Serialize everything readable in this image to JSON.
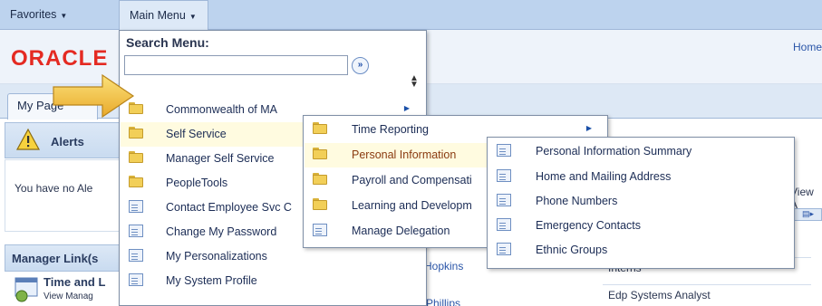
{
  "topbar": {
    "favorites_label": "Favorites",
    "main_menu_label": "Main Menu"
  },
  "header": {
    "logo_text": "ORACLE",
    "home_link": "Home"
  },
  "tabs": {
    "my_page": "My Page"
  },
  "alerts": {
    "title": "Alerts",
    "message": "You have no Ale"
  },
  "manager_links": {
    "title": "Manager Link(s",
    "time_title": "Time and L",
    "view_manage": "View Manag"
  },
  "background": {
    "view_right": "View A",
    "hopkins": "Hopkins",
    "phillips": "Phillips",
    "grid_rows": [
      "Interns",
      "Edp Systems Analyst"
    ]
  },
  "main_menu": {
    "search_title": "Search Menu:",
    "search_placeholder": "",
    "items": [
      {
        "label": "Commonwealth of MA",
        "type": "folder",
        "has_arrow": true
      },
      {
        "label": "Self Service",
        "type": "folder",
        "has_arrow": false,
        "highlighted": true
      },
      {
        "label": "Manager Self Service",
        "type": "folder",
        "has_arrow": false
      },
      {
        "label": "PeopleTools",
        "type": "folder",
        "has_arrow": false
      },
      {
        "label": "Contact Employee Svc C",
        "type": "doc",
        "has_arrow": false
      },
      {
        "label": "Change My Password",
        "type": "doc",
        "has_arrow": false
      },
      {
        "label": "My Personalizations",
        "type": "doc",
        "has_arrow": false
      },
      {
        "label": "My System Profile",
        "type": "doc",
        "has_arrow": false
      }
    ]
  },
  "self_service_menu": {
    "items": [
      {
        "label": "Time Reporting",
        "type": "folder",
        "has_arrow": true
      },
      {
        "label": "Personal Information",
        "type": "folder",
        "highlighted": true
      },
      {
        "label": "Payroll and Compensati",
        "type": "folder"
      },
      {
        "label": "Learning and Developm",
        "type": "folder"
      },
      {
        "label": "Manage Delegation",
        "type": "doc"
      }
    ]
  },
  "personal_info_menu": {
    "items": [
      {
        "label": "Personal Information Summary",
        "type": "doc"
      },
      {
        "label": "Home and Mailing Address",
        "type": "doc"
      },
      {
        "label": "Phone Numbers",
        "type": "doc"
      },
      {
        "label": "Emergency Contacts",
        "type": "doc"
      },
      {
        "label": "Ethnic Groups",
        "type": "doc"
      }
    ]
  },
  "colors": {
    "topbar": "#bdd3ee",
    "highlight": "#fffbe0",
    "oracle_red": "#e42a22",
    "link_blue": "#1b2c55",
    "callout_arrow": "#f5c842"
  },
  "icons": {
    "search_go": "double-chevron-right-icon",
    "sort": "sort-updown-icon",
    "alerts": "warning-triangle-icon",
    "time": "calendar-clock-icon",
    "callout": "yellow-arrow-pointer-icon"
  }
}
